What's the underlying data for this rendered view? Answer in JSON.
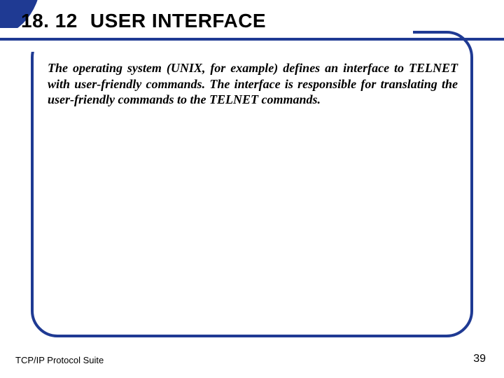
{
  "title": {
    "number": "18. 12",
    "text": "USER INTERFACE"
  },
  "body": "The operating system (UNIX, for example) defines an interface to TELNET with user-friendly commands. The interface is responsible for translating the user-friendly commands to the TELNET commands.",
  "footer": {
    "left": "TCP/IP Protocol Suite",
    "right": "39"
  },
  "theme": {
    "accent": "#1f3a93"
  }
}
